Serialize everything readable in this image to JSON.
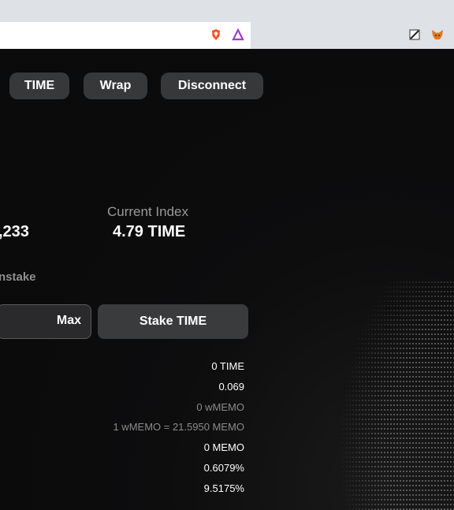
{
  "header": {
    "buttons": {
      "time": "TIME",
      "wrap": "Wrap",
      "disconnect": "Disconnect"
    }
  },
  "stats": {
    "left_value_partial": ",233",
    "current_index_label": "Current Index",
    "current_index_value": "4.79 TIME"
  },
  "tabs": {
    "unstake_partial": "nstake"
  },
  "actions": {
    "max_label": "Max",
    "stake_label": "Stake TIME"
  },
  "details": {
    "values": [
      "0 TIME",
      "0.069",
      "0 wMEMO",
      "1 wMEMO = 21.5950 MEMO",
      "0 MEMO",
      "0.6079%",
      "9.5175%"
    ]
  },
  "colors": {
    "background": "#0b0b0c",
    "button": "#37383a",
    "muted_text": "#8a8a8a"
  }
}
